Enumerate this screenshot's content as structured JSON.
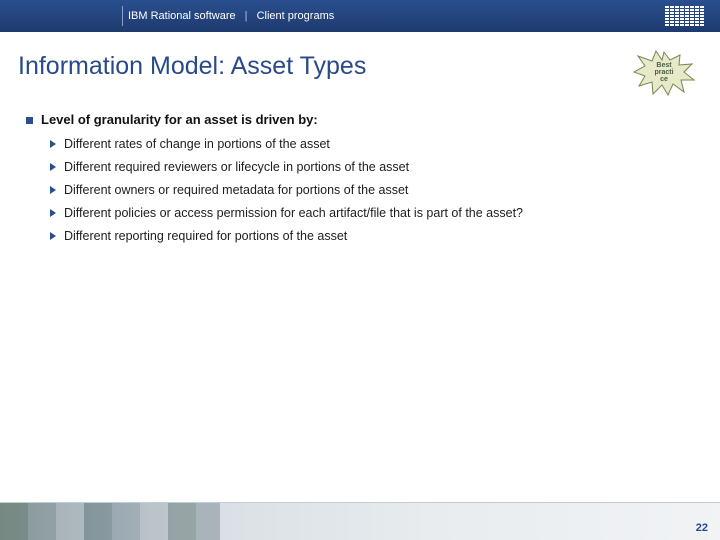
{
  "header": {
    "brand": "IBM Rational software",
    "section": "Client programs"
  },
  "title": "Information Model: Asset Types",
  "badge": {
    "line1": "Best",
    "line2": "practi",
    "line3": "ce"
  },
  "lead": "Level of granularity for an asset is driven by:",
  "bullets": [
    "Different rates of change in portions of the asset",
    "Different required reviewers or lifecycle in portions of the asset",
    "Different owners or required metadata for portions of the asset",
    "Different policies or access permission for each artifact/file that is part of the asset?",
    "Different reporting required for portions of the asset"
  ],
  "page": "22"
}
